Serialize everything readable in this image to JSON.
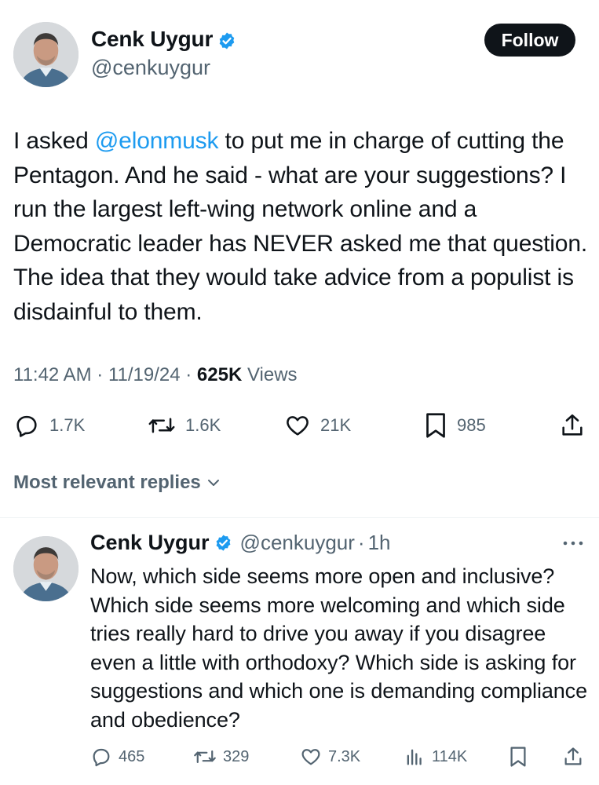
{
  "tweet": {
    "author_name": "Cenk Uygur",
    "author_handle": "@cenkuygur",
    "follow_label": "Follow",
    "text_before": "I asked ",
    "mention": "@elonmusk",
    "text_after": " to put me in charge of cutting the Pentagon. And he said - what are your suggestions? I run the largest left-wing network online and a Democratic leader has NEVER asked me that question. The idea that they would take advice from a populist is disdainful to them.",
    "time": "11:42 AM",
    "date": "11/19/24",
    "views_count": "625K",
    "views_label": "Views",
    "stats": {
      "replies": "1.7K",
      "reposts": "1.6K",
      "likes": "21K",
      "bookmarks": "985"
    }
  },
  "replies_section": {
    "label": "Most relevant replies"
  },
  "reply": {
    "author_name": "Cenk Uygur",
    "author_handle": "@cenkuygur",
    "age": "1h",
    "text": "Now, which side seems more open and inclusive? Which side seems more welcoming and which side tries really hard to drive you away if you disagree even a little with orthodoxy? Which side is asking for suggestions and which one is demanding compliance and obedience?",
    "stats": {
      "replies": "465",
      "reposts": "329",
      "likes": "7.3K",
      "views": "114K"
    }
  },
  "colors": {
    "verified": "#1d9bf0",
    "link": "#1d9bf0",
    "secondary_text": "#536471",
    "primary_text": "#0f1419"
  }
}
